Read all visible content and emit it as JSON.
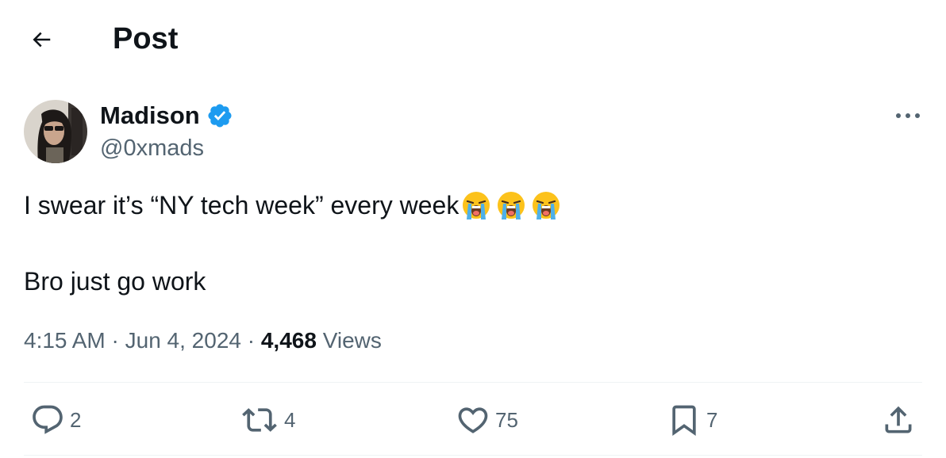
{
  "header": {
    "title": "Post",
    "back_icon": "arrow-left-icon"
  },
  "author": {
    "display_name": "Madison",
    "handle": "@0xmads",
    "verified_icon": "verified-badge-icon",
    "verified_color": "#1d9bf0"
  },
  "tweet": {
    "line1": "I swear it’s “NY tech week” every week",
    "line1_emojis": [
      "loudly-crying-face-icon",
      "loudly-crying-face-icon",
      "loudly-crying-face-icon"
    ],
    "line2": "Bro just go work"
  },
  "meta": {
    "time": "4:15 AM",
    "separator": " · ",
    "date": "Jun 4, 2024",
    "views_count": "4,468",
    "views_label": "Views"
  },
  "actions": {
    "replies": "2",
    "reposts": "4",
    "likes": "75",
    "bookmarks": "7"
  },
  "colors": {
    "text_primary": "#0f1419",
    "text_secondary": "#536471",
    "divider": "#eff3f4",
    "accent": "#1d9bf0"
  }
}
